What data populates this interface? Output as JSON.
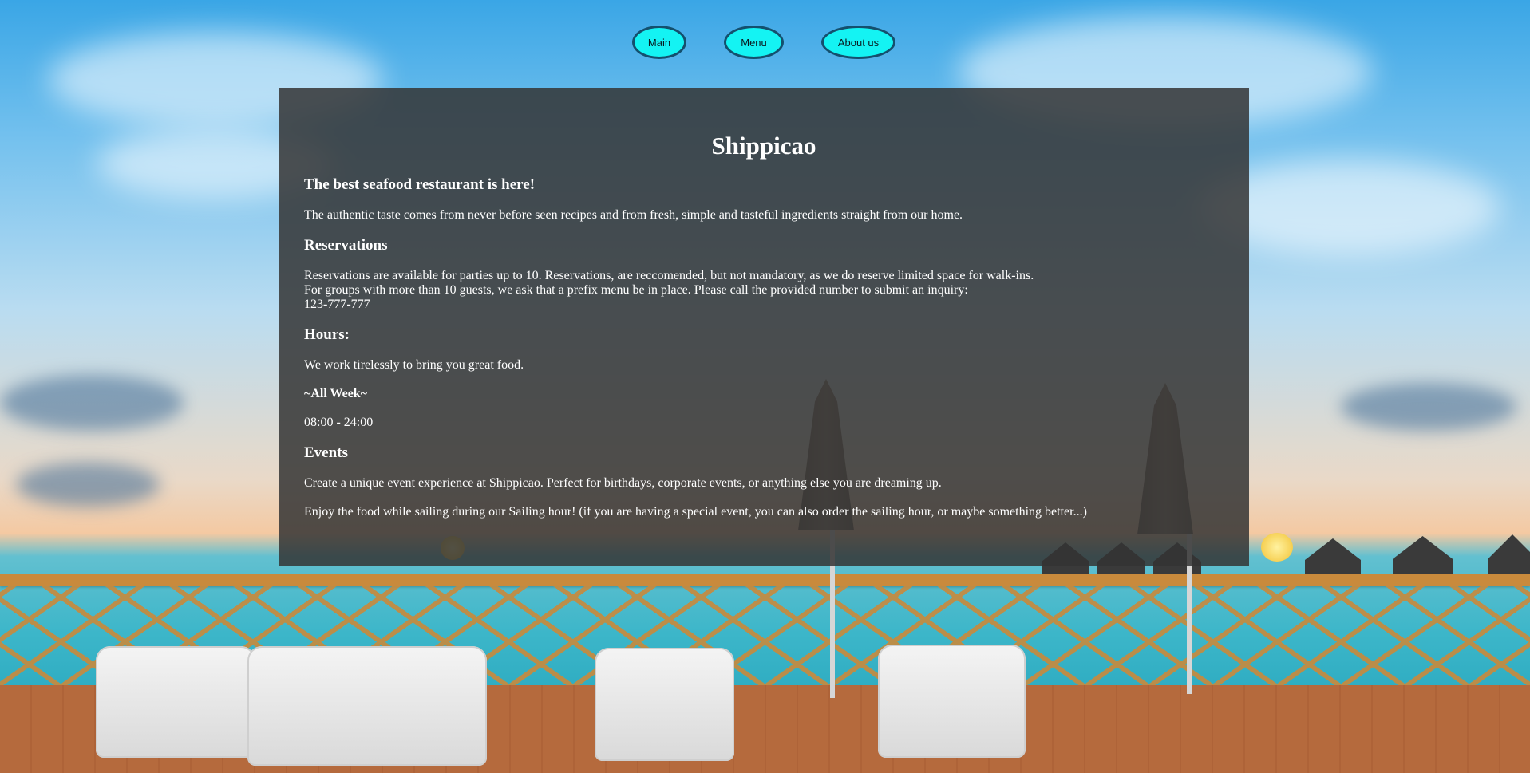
{
  "nav": {
    "main_label": "Main",
    "menu_label": "Menu",
    "about_label": "About us"
  },
  "content": {
    "title": "Shippicao",
    "tagline": "The best seafood restaurant is here!",
    "intro": "The authentic taste comes from never before seen recipes and from fresh, simple and tasteful ingredients straight from our home.",
    "reservations": {
      "heading": "Reservations",
      "line1": "Reservations are available for parties up to 10. Reservations, are reccomended, but not mandatory, as we do reserve limited space for walk-ins.",
      "line2": "For groups with more than 10 guests, we ask that a prefix menu be in place. Please call the provided number to submit an inquiry:",
      "phone": "123-777-777"
    },
    "hours": {
      "heading": "Hours:",
      "text": "We work tirelessly to bring you great food.",
      "days": "~All Week~",
      "time": "08:00 - 24:00"
    },
    "events": {
      "heading": "Events",
      "text1": "Create a unique event experience at Shippicao. Perfect for birthdays, corporate events, or anything else you are dreaming up.",
      "text2": "Enjoy the food while sailing during our Sailing hour! (if you are having a special event, you can also order the sailing hour, or maybe something better...)"
    }
  },
  "colors": {
    "nav_button_bg": "#14f3f3",
    "nav_button_border": "#14506e",
    "panel_bg": "rgba(52,52,52,0.85)"
  }
}
